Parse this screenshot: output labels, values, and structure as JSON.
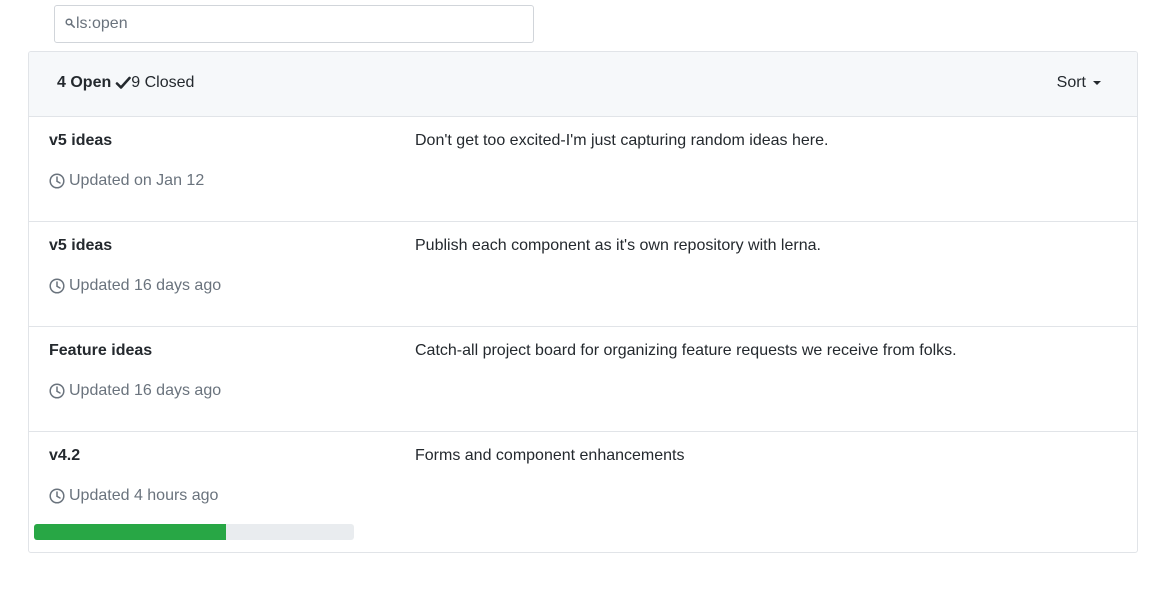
{
  "search": {
    "value": "ls:open",
    "placeholder": ""
  },
  "header": {
    "open_label": "4 Open",
    "closed_label": "9 Closed",
    "sort_label": "Sort"
  },
  "projects": [
    {
      "name": "v5 ideas",
      "updated": "Updated on Jan 12",
      "description": "Don't get too excited-I'm just capturing random ideas here."
    },
    {
      "name": "v5 ideas",
      "updated": "Updated 16 days ago",
      "description": "Publish each component as it's own repository with lerna."
    },
    {
      "name": "Feature ideas",
      "updated": "Updated 16 days ago",
      "description": "Catch-all project board for organizing feature requests we receive from folks."
    },
    {
      "name": "v4.2",
      "updated": "Updated 4 hours ago",
      "description": "Forms and component enhancements",
      "progress": 0.6
    }
  ],
  "colors": {
    "progress": "#28a745",
    "progress_track": "#e9ecef"
  },
  "icons": {
    "search": "search-icon",
    "check": "check-icon",
    "clock": "clock-icon"
  }
}
